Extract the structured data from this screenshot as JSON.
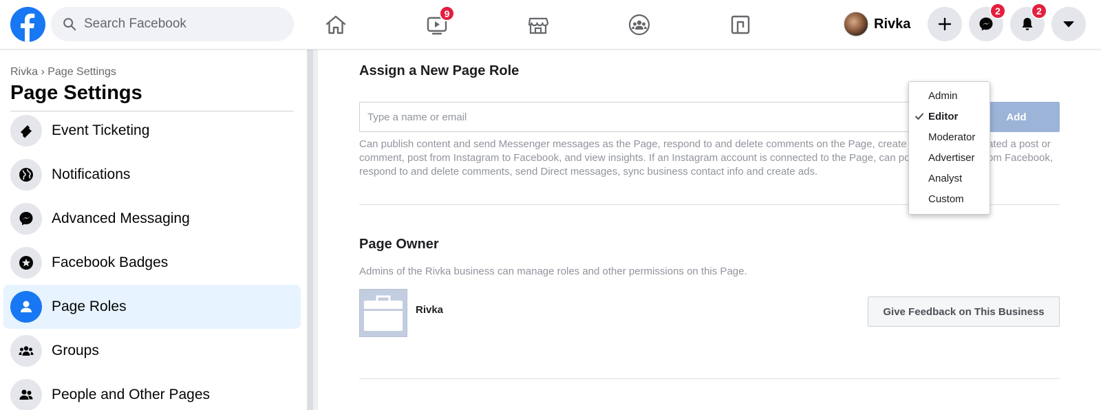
{
  "topbar": {
    "search_placeholder": "Search Facebook",
    "watch_badge": "9",
    "profile_name": "Rivka",
    "messenger_badge": "2",
    "notifications_badge": "2"
  },
  "sidebar": {
    "breadcrumb": "Rivka › Page Settings",
    "title": "Page Settings",
    "items": [
      {
        "label": "Event Ticketing",
        "icon": "ticket-icon"
      },
      {
        "label": "Notifications",
        "icon": "globe-icon"
      },
      {
        "label": "Advanced Messaging",
        "icon": "messenger-icon"
      },
      {
        "label": "Facebook Badges",
        "icon": "star-badge-icon"
      },
      {
        "label": "Page Roles",
        "icon": "person-icon",
        "active": true
      },
      {
        "label": "Groups",
        "icon": "groups-icon"
      },
      {
        "label": "People and Other Pages",
        "icon": "people-icon"
      }
    ]
  },
  "assign": {
    "title": "Assign a New Page Role",
    "input_placeholder": "Type a name or email",
    "add_label": "Add",
    "description": "Can publish content and send Messenger messages as the Page, respond to and delete comments on the Page, create ads, see who created a post or comment, post from Instagram to Facebook, and view insights. If an Instagram account is connected to the Page, can post to Instagram from Facebook, respond to and delete comments, send Direct messages, sync business contact info and create ads."
  },
  "role_menu": {
    "options": [
      "Admin",
      "Editor",
      "Moderator",
      "Advertiser",
      "Analyst",
      "Custom"
    ],
    "selected": "Editor"
  },
  "owner": {
    "title": "Page Owner",
    "description": "Admins of the Rivka business can manage roles and other permissions on this Page.",
    "business_name": "Rivka",
    "feedback_label": "Give Feedback on This Business"
  },
  "colors": {
    "brand": "#1877f2",
    "badge": "#e41e3f",
    "active_bg": "#e7f3ff"
  }
}
